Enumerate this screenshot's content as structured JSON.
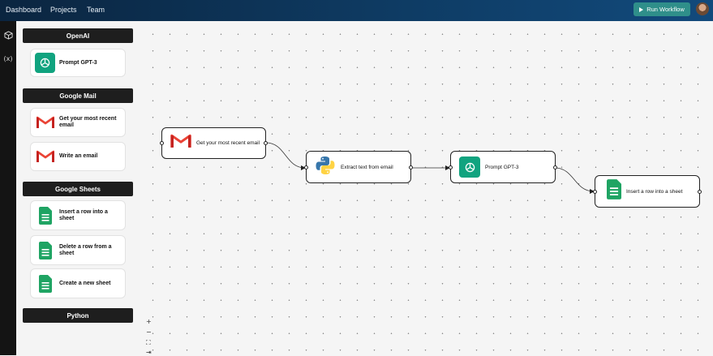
{
  "topbar": {
    "nav": [
      "Dashboard",
      "Projects",
      "Team"
    ],
    "run_label": "Run Workflow"
  },
  "rail": {
    "icons": [
      "cube-icon",
      "variable-icon"
    ],
    "variable_text": "(x)"
  },
  "sidebar": {
    "categories": [
      {
        "title": "OpenAI",
        "items": [
          {
            "label": "Prompt GPT-3",
            "icon": "openai-icon"
          }
        ]
      },
      {
        "title": "Google Mail",
        "items": [
          {
            "label": "Get your most recent email",
            "icon": "gmail-icon"
          },
          {
            "label": "Write an email",
            "icon": "gmail-icon"
          }
        ]
      },
      {
        "title": "Google Sheets",
        "items": [
          {
            "label": "Insert a row into a sheet",
            "icon": "sheets-icon"
          },
          {
            "label": "Delete a row from a sheet",
            "icon": "sheets-icon"
          },
          {
            "label": "Create a new sheet",
            "icon": "sheets-icon"
          }
        ]
      },
      {
        "title": "Python",
        "items": []
      }
    ]
  },
  "workflow": {
    "nodes": [
      {
        "label": "Get your most recent email",
        "icon": "gmail-icon"
      },
      {
        "label": "Extract text from email",
        "icon": "python-icon"
      },
      {
        "label": "Prompt GPT-3",
        "icon": "openai-icon"
      },
      {
        "label": "Insert a row into a sheet",
        "icon": "sheets-icon"
      }
    ]
  },
  "zoom_controls": [
    "+",
    "−",
    "⛶",
    "⇥"
  ],
  "colors": {
    "topbar": "#0e3b63",
    "run_button": "#2f8f8a",
    "openai": "#10a37f",
    "sheets": "#1fa463",
    "gmail": "#ea4335"
  }
}
